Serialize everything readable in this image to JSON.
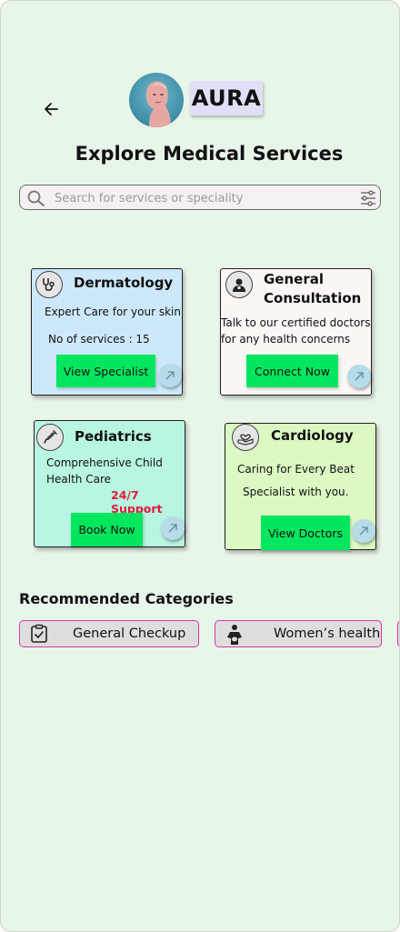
{
  "header": {
    "brand": "AURA",
    "title": "Explore Medical Services"
  },
  "search": {
    "placeholder": "Search for services or speciality"
  },
  "cards": [
    {
      "title": "Dermatology",
      "subtitle": "Expert Care for your skin",
      "info": "No of services : 15",
      "button": "View Specialist",
      "icon": "stethoscope-icon",
      "bg": "#cde8fb"
    },
    {
      "title_line1": "General",
      "title_line2": "Consultation",
      "text_line1": "Talk to our certified doctors",
      "text_line2": "for any health concerns",
      "button": "Connect Now",
      "icon": "doctor-icon",
      "bg": "#fbf7f5"
    },
    {
      "title": "Pediatrics",
      "text_line1": "Comprehensive Child",
      "text_line2": "Health Care",
      "badge": "24/7 Support",
      "button": "Book Now",
      "icon": "syringe-icon",
      "bg": "#b8f5e2"
    },
    {
      "title": "Cardiology",
      "text_line1": "Caring for Every Beat",
      "text_line2": "Specialist with you.",
      "button": "View Doctors",
      "icon": "heart-hand-icon",
      "bg": "#dcf9c4"
    }
  ],
  "recommended": {
    "title": "Recommended Categories",
    "items": [
      {
        "label": "General Checkup",
        "icon": "clipboard-check-icon"
      },
      {
        "label": "Women’s health",
        "icon": "pregnant-woman-icon"
      }
    ]
  },
  "colors": {
    "background": "#e8f5e9",
    "accent_button": "#00e65f",
    "support_badge": "#e31b3c",
    "category_border": "#d63aa6"
  }
}
